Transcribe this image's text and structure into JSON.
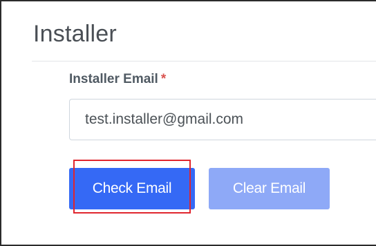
{
  "panel": {
    "title": "Installer"
  },
  "form": {
    "email_label": "Installer Email",
    "required_marker": "*",
    "email_value": "test.installer@gmail.com"
  },
  "actions": {
    "check_email_label": "Check Email",
    "clear_email_label": "Clear Email"
  },
  "colors": {
    "primary_button": "#3569f5",
    "secondary_button": "#8ea9f7",
    "highlight_annotation": "#e0252d",
    "required_marker": "#d9534f"
  }
}
